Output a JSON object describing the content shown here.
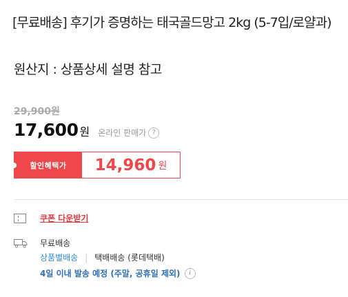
{
  "product": {
    "title": "[무료배송] 후기가 증명하는 태국골드망고 2kg (5-7입/로얄과)",
    "origin": "원산지 : 상품상세 설명 참고"
  },
  "price": {
    "original": "29,900원",
    "current": "17,600",
    "currency": "원",
    "online_label": "온라인 판매가",
    "help_symbol": "?"
  },
  "discount": {
    "label": "할인혜택가",
    "price": "14,960",
    "currency": "원"
  },
  "coupon": {
    "link_text": "쿠폰 다운받기"
  },
  "shipping": {
    "fee": "무료배송",
    "by_product": "상품별배송",
    "separator": "|",
    "method": "택배배송 (롯데택배)",
    "delivery_note": "4일 이내 발송 예정 (주말, 공휴일 제외)",
    "info_symbol": "i"
  },
  "colors": {
    "accent_red": "#f0484a",
    "link_blue": "#2f8bd2",
    "delivery_blue": "#2f6fb5"
  }
}
